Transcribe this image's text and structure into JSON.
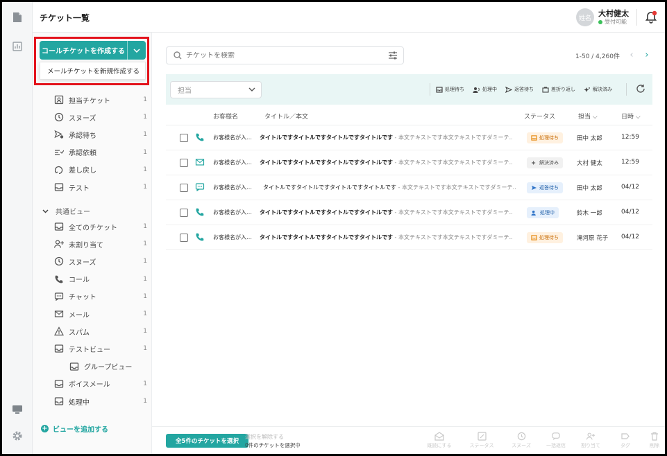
{
  "header": {
    "title": "チケット一覧",
    "user": {
      "avatar_text": "姓名",
      "name": "大村健太",
      "status": "受付可能"
    }
  },
  "sidebar": {
    "create_button": "コールチケットを作成する",
    "dropdown_item": "メールチケットを新規作成する",
    "personal_items": [
      {
        "label": "担当チケット",
        "count": "1",
        "icon": "assigned-ticket-icon"
      },
      {
        "label": "スヌーズ",
        "count": "1",
        "icon": "clock-icon"
      },
      {
        "label": "承認待ち",
        "count": "1",
        "icon": "approval-wait-icon"
      },
      {
        "label": "承認依頼",
        "count": "1",
        "icon": "approval-request-icon"
      },
      {
        "label": "差し戻し",
        "count": "1",
        "icon": "return-icon"
      },
      {
        "label": "テスト",
        "count": "1",
        "icon": "inbox-icon"
      }
    ],
    "shared_title": "共通ビュー",
    "shared_items": [
      {
        "label": "全てのチケット",
        "count": "1",
        "icon": "inbox-icon"
      },
      {
        "label": "未割り当て",
        "count": "1",
        "icon": "user-plus-icon"
      },
      {
        "label": "スヌーズ",
        "count": "1",
        "icon": "clock-icon"
      },
      {
        "label": "コール",
        "count": "1",
        "icon": "phone-icon"
      },
      {
        "label": "チャット",
        "count": "1",
        "icon": "chat-icon"
      },
      {
        "label": "メール",
        "count": "1",
        "icon": "mail-icon"
      },
      {
        "label": "スパム",
        "count": "1",
        "icon": "warning-icon"
      },
      {
        "label": "テストビュー",
        "count": "1",
        "icon": "inbox-icon"
      },
      {
        "label": "グループビュー",
        "count": "",
        "icon": "inbox-icon"
      },
      {
        "label": "ボイスメール",
        "count": "1",
        "icon": "inbox-icon"
      },
      {
        "label": "処理中",
        "count": "1",
        "icon": "inbox-icon"
      }
    ],
    "add_view": "ビューを追加する"
  },
  "search": {
    "placeholder": "チケットを検索"
  },
  "pager": {
    "range": "1-50 / 4,260件"
  },
  "toolbar": {
    "assignee_select": "担当",
    "filters": [
      "処理待ち",
      "処理中",
      "返答待ち",
      "差折り返し",
      "解決済み"
    ]
  },
  "table": {
    "headers": {
      "customer": "お客様名",
      "subject": "タイトル／本文",
      "status": "ステータス",
      "assignee": "担当",
      "time": "日時"
    },
    "rows": [
      {
        "channel": "phone-icon",
        "customer": "お客様名が入…",
        "title": "タイトルですタイトルですタイトルですタイトルです",
        "body": " - 本文テキストです本文テキストですダミーテ…",
        "status": "処理待ち",
        "status_type": "pending",
        "assignee": "田中 太郎",
        "time": "12:59"
      },
      {
        "channel": "mail-icon",
        "customer": "お客様名が入…",
        "title": "タイトルですタイトルですタイトルですタイトルです",
        "body": " - 本文テキストです本文テキストですダミーテ…",
        "status": "解決済み",
        "status_type": "resolved",
        "assignee": "大村 健太",
        "time": "12:59"
      },
      {
        "channel": "chat-icon",
        "customer": "お客様名が入…",
        "title": "タイトルですタイトルですタイトルですタイトルです",
        "body": " - 本文テキストです本文テキストですダミーテ…",
        "status": "返答待ち",
        "status_type": "waiting",
        "assignee": "田中 太郎",
        "time": "04/12"
      },
      {
        "channel": "phone-icon",
        "customer": "お客様名が入…",
        "title": "タイトルですタイトルですタイトルですタイトルです",
        "body": " - 本文テキストです本文テキストですダミーテ…",
        "status": "処理中",
        "status_type": "processing",
        "assignee": "鈴木 一郎",
        "time": "04/12"
      },
      {
        "channel": "phone-icon",
        "customer": "お客様名が入…",
        "title": "タイトルですタイトルですタイトルですタイトルです",
        "body": " - 本文テキストです本文テキストですダミーテ…",
        "status": "処理待ち",
        "status_type": "pending",
        "assignee": "滝河原 花子",
        "time": "04/12"
      }
    ]
  },
  "footer": {
    "select_all": "全5件のチケットを選択",
    "clear": "選択を解除する",
    "selected_count": "0件のチケットを選択中",
    "actions": [
      "既読にする",
      "ステータス",
      "スヌーズ",
      "一括返信",
      "割り当て",
      "タグ",
      "削除"
    ]
  },
  "colors": {
    "accent": "#23a6a1",
    "highlight": "#e3131c",
    "toolbar_bg": "#e9f6f5"
  }
}
